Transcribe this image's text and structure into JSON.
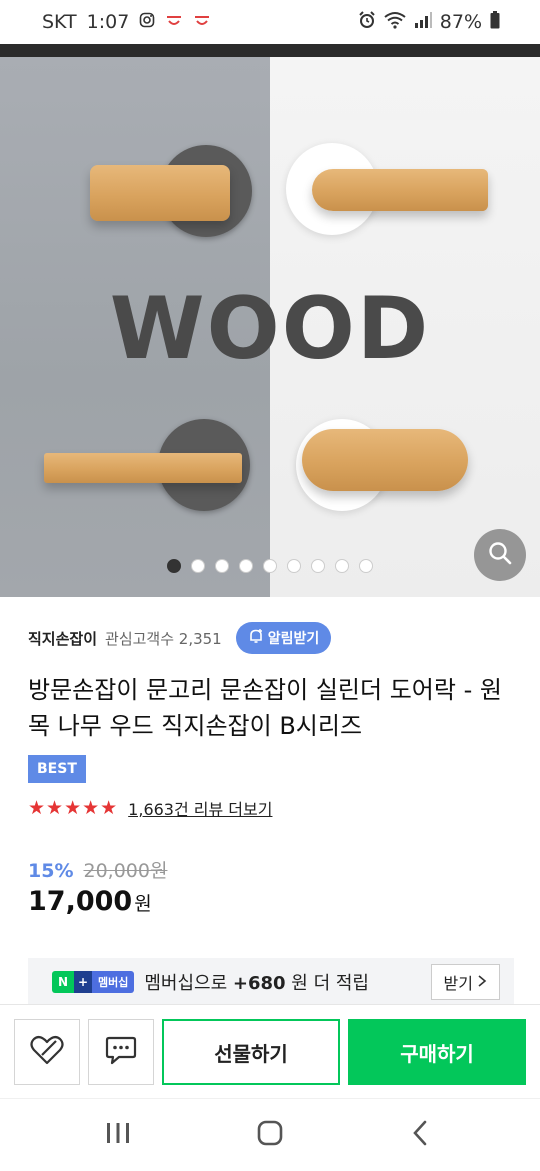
{
  "status_bar": {
    "carrier": "SKT",
    "time": "1:07",
    "battery": "87%",
    "icons": [
      "instagram-icon",
      "notification-icon",
      "notification-icon",
      "alarm-icon",
      "wifi-icon",
      "signal-icon",
      "battery-icon"
    ]
  },
  "hero": {
    "overlay_text": "WOOD",
    "slide_count": 9,
    "active_slide": 1
  },
  "store": {
    "name": "직지손잡이",
    "followers_label": "관심고객수 2,351",
    "alarm_button": "알림받기"
  },
  "product": {
    "title": "방문손잡이 문고리 문손잡이 실린더 도어락 - 원목 나무 우드 직지손잡이 B시리즈",
    "badge": "BEST",
    "stars": "★★★★★",
    "review_link": "1,663건 리뷰 더보기",
    "discount": "15%",
    "original_price": "20,000원",
    "price": "17,000",
    "price_unit": "원"
  },
  "membership": {
    "badge_n": "N",
    "badge_plus": "+",
    "badge_label": "멤버십",
    "text_prefix": "멤버십으로 ",
    "points": "+680",
    "text_suffix": " 원 더 적립",
    "receive_button": "받기"
  },
  "actions": {
    "gift_button": "선물하기",
    "buy_button": "구매하기"
  },
  "colors": {
    "accent_blue": "#5f8ae6",
    "naver_green": "#03c75a",
    "star_red": "#e53535"
  }
}
